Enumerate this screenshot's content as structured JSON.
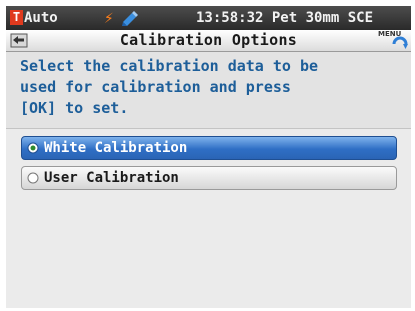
{
  "status_bar": {
    "mode_badge": "T",
    "mode_label": "Auto",
    "icons": [
      "bolt-icon",
      "pen-icon"
    ],
    "status_text": "13:58:32 Pet 30mm SCE",
    "colors": {
      "mode_badge": "#e03a1e",
      "bolt": "#ff7f1a"
    }
  },
  "title_bar": {
    "title": "Calibration Options",
    "back_icon": "back-icon",
    "menu_label": "MENU"
  },
  "instruction": {
    "text": "Select the calibration data to be\nused for calibration and press\n[OK] to set.",
    "color": "#1d5e99"
  },
  "options": [
    {
      "label": "White Calibration",
      "selected": true
    },
    {
      "label": "User Calibration",
      "selected": false
    }
  ],
  "colors": {
    "selected_option": "#2f6fc5",
    "unselected_option": "#d6d6d6",
    "background": "#ebebeb"
  }
}
